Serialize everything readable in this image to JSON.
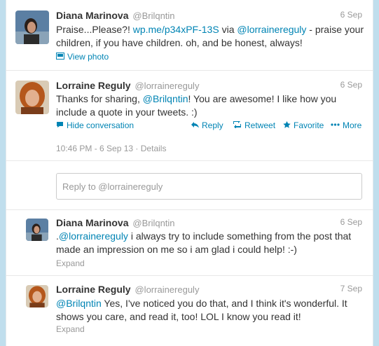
{
  "tweets": [
    {
      "name": "Diana Marinova",
      "handle": "@Brilqntin",
      "date": "6 Sep",
      "text_parts": [
        "Praise...Please?! ",
        "wp.me/p34xPF-13S",
        " via ",
        "@lorrainereguly",
        " - praise your children, if you have children. oh, and be honest, always!"
      ],
      "action": "View photo"
    },
    {
      "name": "Lorraine Reguly",
      "handle": "@lorrainereguly",
      "date": "6 Sep",
      "text_parts": [
        "Thanks for sharing, ",
        "@Brilqntin",
        "! You are awesome! I like how you include a quote in your tweets. :)"
      ],
      "actions": {
        "hide": "Hide conversation",
        "reply": "Reply",
        "retweet": "Retweet",
        "favorite": "Favorite",
        "more": "More"
      },
      "timestamp": "10:46 PM - 6 Sep 13",
      "details": "Details",
      "reply_placeholder": "Reply to @lorrainereguly"
    },
    {
      "name": "Diana Marinova",
      "handle": "@Brilqntin",
      "date": "6 Sep",
      "text_parts": [
        ".",
        "@lorrainereguly",
        " i always try to include something from the post that made an impression on me so i am glad i could help! :-)"
      ],
      "expand": "Expand"
    },
    {
      "name": "Lorraine Reguly",
      "handle": "@lorrainereguly",
      "date": "7 Sep",
      "text_parts": [
        "@Brilqntin",
        "  Yes, I've noticed you do that, and I think it's wonderful. It shows you care, and read it, too! LOL I know you read it!"
      ],
      "expand": "Expand"
    }
  ],
  "icons": {
    "photo": "photo-icon",
    "conversation": "speech-bubble-icon",
    "reply": "reply-arrow-icon",
    "retweet": "retweet-icon",
    "favorite": "star-icon",
    "more": "more-dots-icon"
  },
  "colors": {
    "link": "#0084b4",
    "background": "#c0deed",
    "muted": "#999999"
  }
}
